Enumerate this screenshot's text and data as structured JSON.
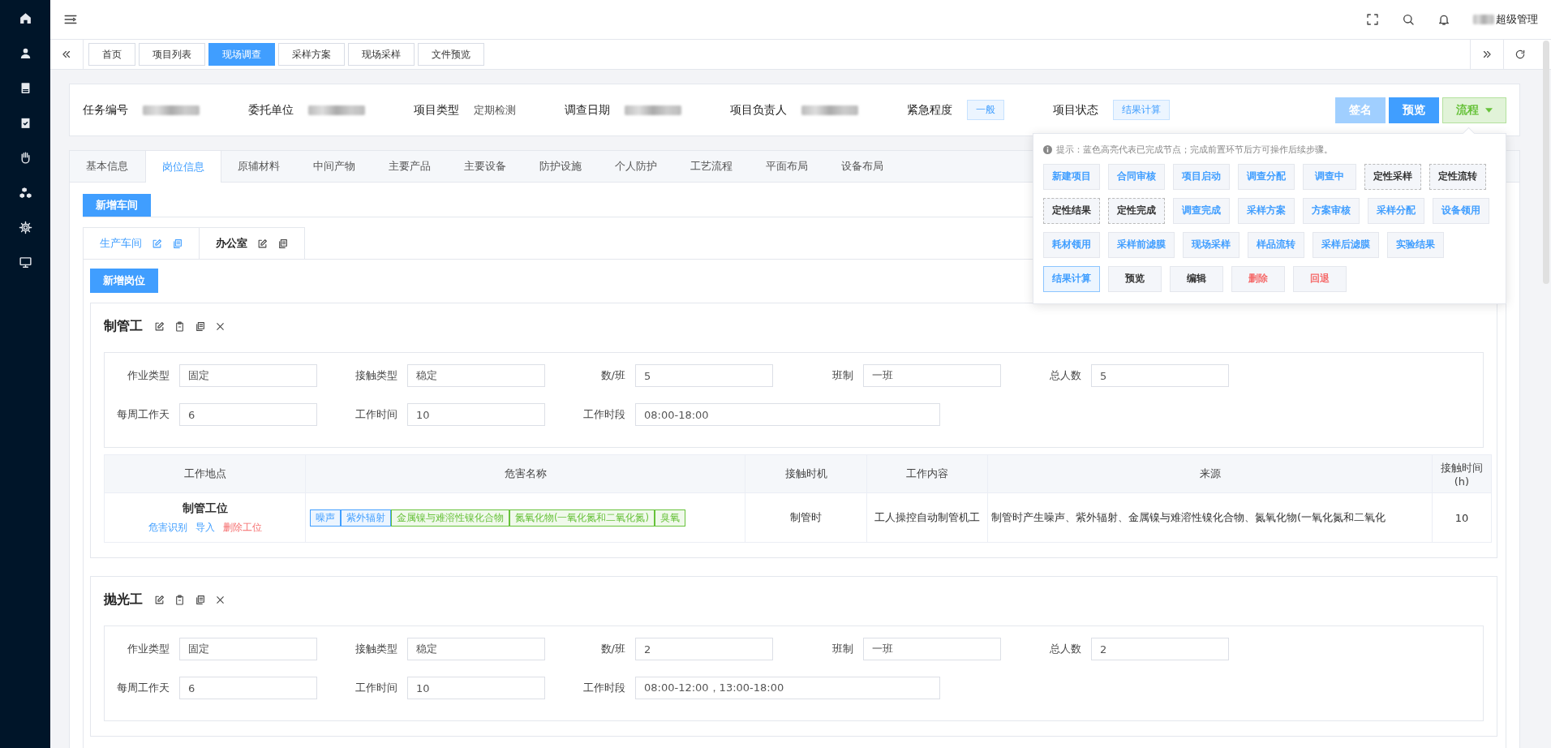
{
  "top_bar": {
    "user_name": "超级管理"
  },
  "page_tabs": [
    {
      "label": "首页",
      "selected": false
    },
    {
      "label": "项目列表",
      "selected": false
    },
    {
      "label": "现场调查",
      "selected": true
    },
    {
      "label": "采样方案",
      "selected": false
    },
    {
      "label": "现场采样",
      "selected": false
    },
    {
      "label": "文件预览",
      "selected": false
    }
  ],
  "task_header": {
    "fields": [
      {
        "label": "任务编号",
        "kind": "redacted"
      },
      {
        "label": "委托单位",
        "kind": "redacted"
      },
      {
        "label": "项目类型",
        "kind": "text",
        "value": "定期检测"
      },
      {
        "label": "调查日期",
        "kind": "redacted"
      },
      {
        "label": "项目负责人",
        "kind": "redacted"
      },
      {
        "label": "紧急程度",
        "kind": "tag",
        "value": "一般"
      },
      {
        "label": "项目状态",
        "kind": "tag",
        "value": "结果计算"
      }
    ],
    "buttons": [
      {
        "label": "签名",
        "kind": "primary",
        "disabled": true
      },
      {
        "label": "预览",
        "kind": "primary",
        "disabled": false
      },
      {
        "label": "流程",
        "kind": "dropdown",
        "expanded": true
      }
    ]
  },
  "flow_popup": {
    "hint": "提示：蓝色高亮代表已完成节点；完成前置环节后方可操作后续步骤。",
    "steps": [
      {
        "label": "新建项目",
        "kind": "done"
      },
      {
        "label": "合同审核",
        "kind": "done"
      },
      {
        "label": "项目启动",
        "kind": "done"
      },
      {
        "label": "调查分配",
        "kind": "done"
      },
      {
        "label": "调查中",
        "kind": "done"
      },
      {
        "label": "定性采样",
        "kind": "pending"
      },
      {
        "label": "定性流转",
        "kind": "pending"
      },
      {
        "label": "定性结果",
        "kind": "pending"
      },
      {
        "label": "定性完成",
        "kind": "pending"
      },
      {
        "label": "调查完成",
        "kind": "done"
      },
      {
        "label": "采样方案",
        "kind": "done"
      },
      {
        "label": "方案审核",
        "kind": "done"
      },
      {
        "label": "采样分配",
        "kind": "done"
      },
      {
        "label": "设备领用",
        "kind": "done"
      },
      {
        "label": "耗材领用",
        "kind": "done"
      },
      {
        "label": "采样前滤膜",
        "kind": "done"
      },
      {
        "label": "现场采样",
        "kind": "done"
      },
      {
        "label": "样品流转",
        "kind": "done"
      },
      {
        "label": "采样后滤膜",
        "kind": "done"
      },
      {
        "label": "实验结果",
        "kind": "done"
      },
      {
        "label": "结果计算",
        "kind": "current"
      },
      {
        "label": "预览",
        "kind": "action"
      },
      {
        "label": "编辑",
        "kind": "action"
      },
      {
        "label": "删除",
        "kind": "danger"
      },
      {
        "label": "回退",
        "kind": "danger"
      }
    ]
  },
  "section_tabs": [
    {
      "label": "基本信息",
      "selected": false
    },
    {
      "label": "岗位信息",
      "selected": true
    },
    {
      "label": "原辅材料",
      "selected": false
    },
    {
      "label": "中间产物",
      "selected": false
    },
    {
      "label": "主要产品",
      "selected": false
    },
    {
      "label": "主要设备",
      "selected": false
    },
    {
      "label": "防护设施",
      "selected": false
    },
    {
      "label": "个人防护",
      "selected": false
    },
    {
      "label": "工艺流程",
      "selected": false
    },
    {
      "label": "平面布局",
      "selected": false
    },
    {
      "label": "设备布局",
      "selected": false
    }
  ],
  "add_workshop_button": "新增车间",
  "workshops": [
    {
      "name": "生产车间",
      "selected": true
    },
    {
      "name": "办公室",
      "selected": false
    }
  ],
  "add_position_button": "新增岗位",
  "positions": [
    {
      "name": "制管工",
      "fields": [
        {
          "label": "作业类型",
          "value": "固定"
        },
        {
          "label": "接触类型",
          "value": "稳定"
        },
        {
          "label": "数/班",
          "value": "5"
        },
        {
          "label": "班制",
          "value": "一班"
        },
        {
          "label": "总人数",
          "value": "5"
        },
        {
          "label": "每周工作天",
          "value": "6"
        },
        {
          "label": "工作时间",
          "value": "10"
        },
        {
          "label": "工作时段",
          "value": "08:00-18:00"
        }
      ],
      "table": {
        "columns": [
          "工作地点",
          "危害名称",
          "接触时机",
          "工作内容",
          "来源",
          "接触时间(h)"
        ],
        "rows": [
          {
            "location": "制管工位",
            "actions": [
              {
                "label": "危害识别",
                "kind": "link"
              },
              {
                "label": "导入",
                "kind": "link"
              },
              {
                "label": "删除工位",
                "kind": "danger"
              }
            ],
            "hazards": [
              {
                "name": "噪声",
                "color": "#409eff"
              },
              {
                "name": "紫外辐射",
                "color": "#409eff"
              },
              {
                "name": "金属镍与难溶性镍化合物",
                "color": "#67c23a"
              },
              {
                "name": "氮氧化物(一氧化氮和二氧化氮)",
                "color": "#67c23a"
              },
              {
                "name": "臭氧",
                "color": "#67c23a"
              }
            ],
            "timing": "制管时",
            "work_content": "工人操控自动制管机工",
            "source": "制管时产生噪声、紫外辐射、金属镍与难溶性镍化合物、氮氧化物(一氧化氮和二氧化",
            "exposure_hours": "10"
          }
        ]
      }
    },
    {
      "name": "抛光工",
      "fields": [
        {
          "label": "作业类型",
          "value": "固定"
        },
        {
          "label": "接触类型",
          "value": "稳定"
        },
        {
          "label": "数/班",
          "value": "2"
        },
        {
          "label": "班制",
          "value": "一班"
        },
        {
          "label": "总人数",
          "value": "2"
        },
        {
          "label": "每周工作天",
          "value": "6"
        },
        {
          "label": "工作时间",
          "value": "10"
        },
        {
          "label": "工作时段",
          "value": "08:00-12:00，13:00-18:00"
        }
      ]
    }
  ]
}
